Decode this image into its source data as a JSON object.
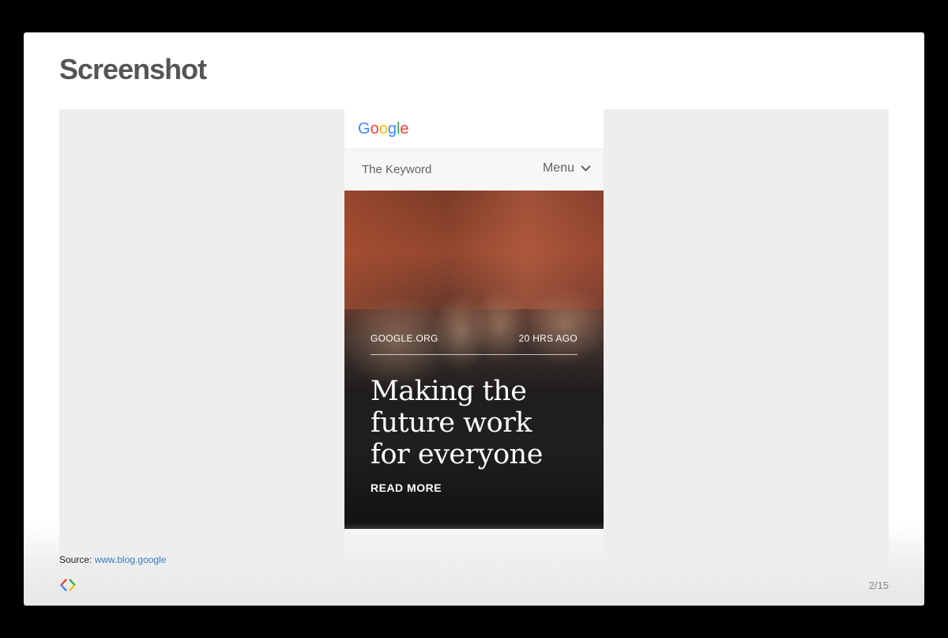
{
  "slide": {
    "title": "Screenshot",
    "source_label": "Source:",
    "source_link": "www.blog.google",
    "page": "2/15"
  },
  "phone": {
    "logo": [
      "G",
      "o",
      "o",
      "g",
      "l",
      "e"
    ],
    "logo_colors": [
      "#4285F4",
      "#EA4335",
      "#FBBC05",
      "#4285F4",
      "#34A853",
      "#EA4335"
    ],
    "nav_title": "The Keyword",
    "menu_label": "Menu",
    "hero": {
      "category": "GOOGLE.ORG",
      "time": "20 HRS AGO",
      "headline": "Making the future work for everyone",
      "cta": "READ MORE"
    }
  },
  "colors": {
    "link": "#3a78c2",
    "title": "#555555"
  },
  "icons": {
    "menu": "chevron-down-icon",
    "brand": "google-developers-logo"
  }
}
